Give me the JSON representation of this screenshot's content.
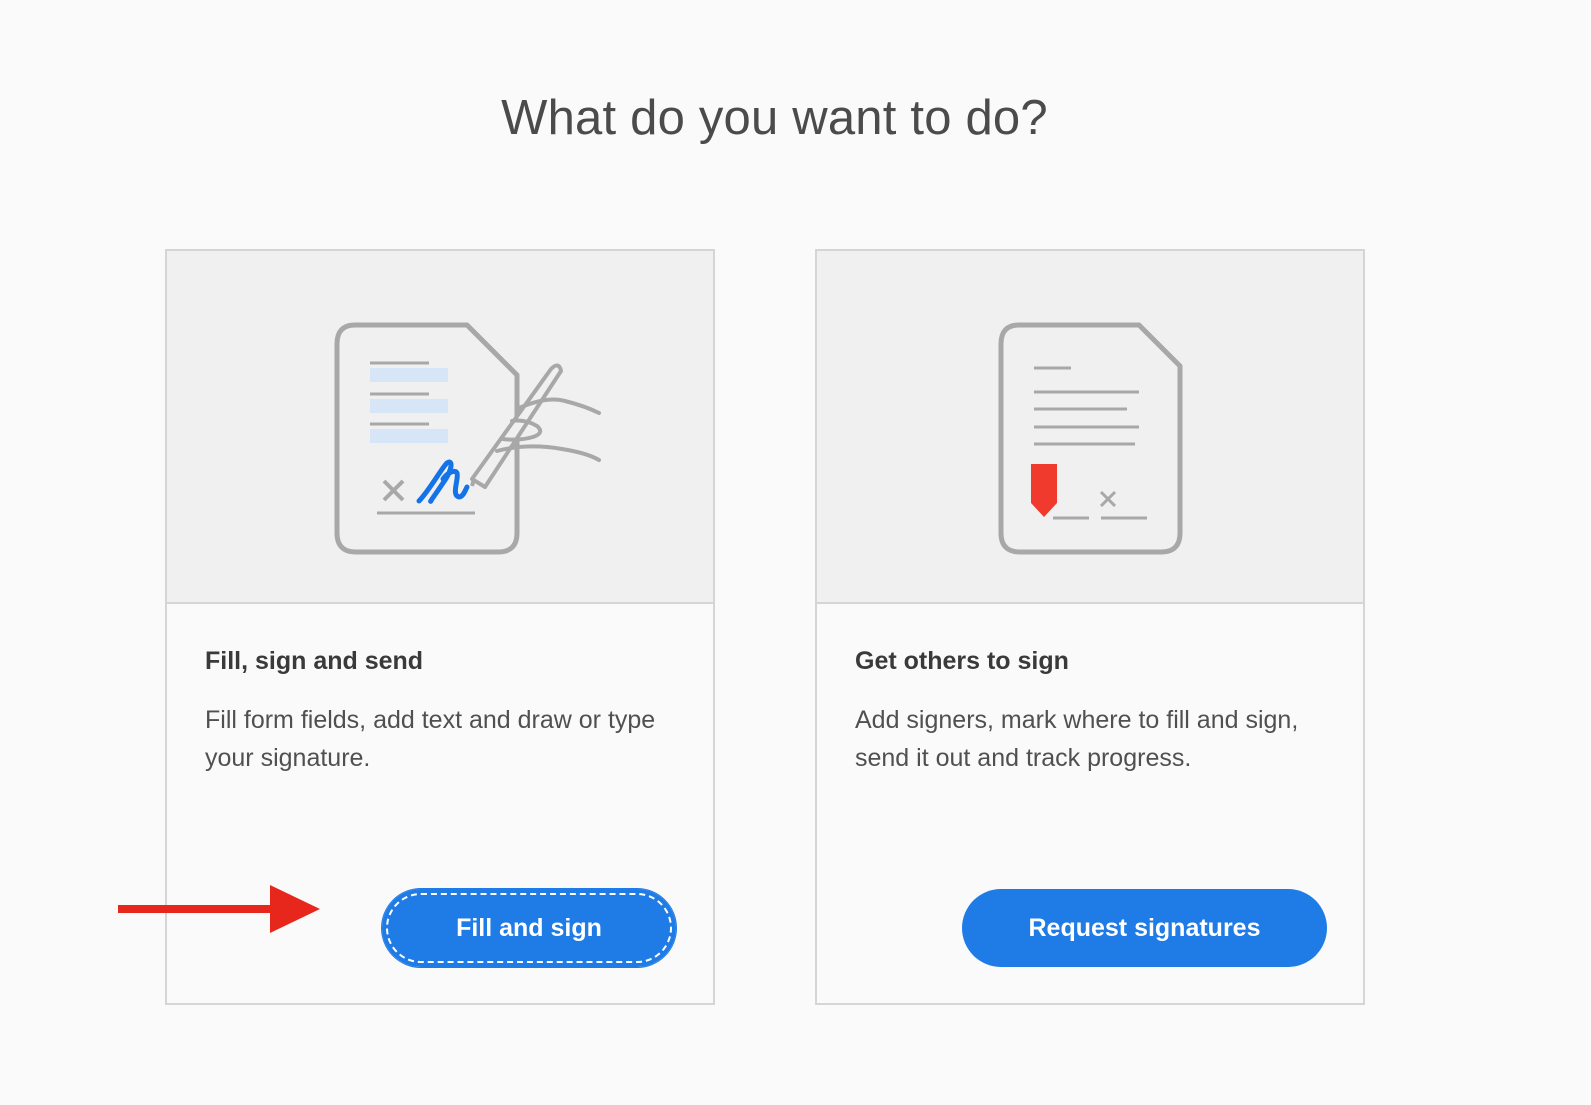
{
  "page": {
    "title": "What do you want to do?"
  },
  "cards": [
    {
      "heading": "Fill, sign and send",
      "description": "Fill form fields, add text and draw or type your signature.",
      "button_label": "Fill and sign",
      "focused": true
    },
    {
      "heading": "Get others to sign",
      "description": "Add signers, mark where to fill and sign, send it out and track progress.",
      "button_label": "Request signatures",
      "focused": false
    }
  ],
  "icons": {
    "card1": "fill-sign-document-icon",
    "card2": "request-signature-document-icon",
    "annotation": "red-arrow-pointer"
  },
  "colors": {
    "accent": "#1f7be5",
    "annotation": "#e8271c",
    "signature": "#1473e6",
    "field_highlight": "#d6e6f7",
    "marker": "#f03a2e"
  }
}
